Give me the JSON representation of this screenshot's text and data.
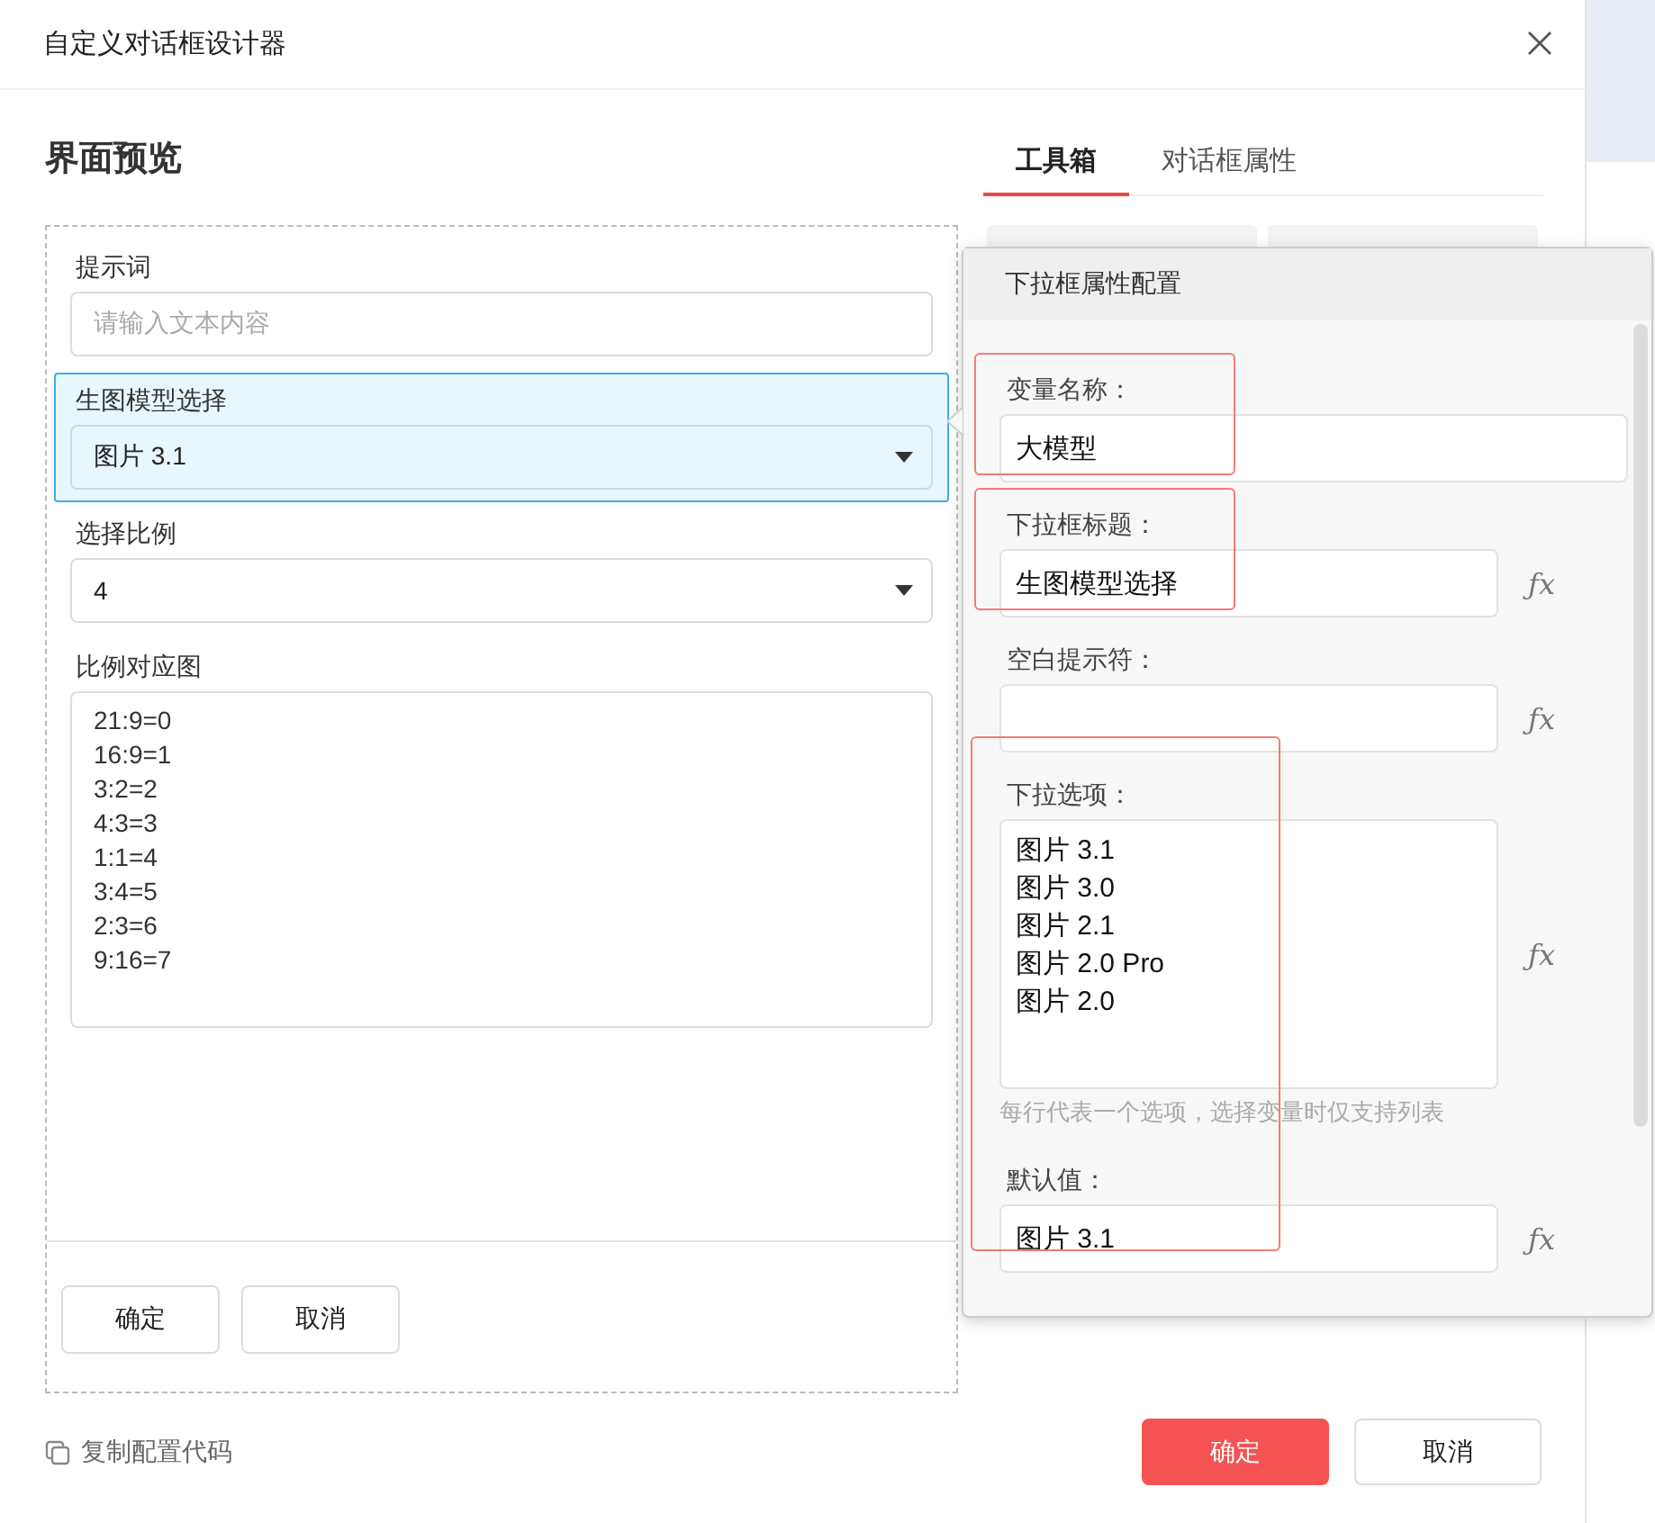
{
  "window": {
    "title": "自定义对话框设计器"
  },
  "preview": {
    "title": "界面预览",
    "items": [
      {
        "kind": "input",
        "label": "提示词",
        "placeholder": "请输入文本内容",
        "selected": false
      },
      {
        "kind": "select",
        "label": "生图模型选择",
        "value": "图片 3.1",
        "selected": true
      },
      {
        "kind": "select",
        "label": "选择比例",
        "value": "4",
        "selected": false
      },
      {
        "kind": "textarea",
        "label": "比例对应图",
        "value": "21:9=0\n16:9=1\n3:2=2\n4:3=3\n1:1=4\n3:4=5\n2:3=6\n9:16=7",
        "selected": false
      }
    ],
    "buttons": [
      "确定",
      "取消"
    ]
  },
  "copy_link": "复制配置代码",
  "tabs": [
    {
      "label": "工具箱",
      "selected": true
    },
    {
      "label": "对话框属性",
      "selected": false
    }
  ],
  "popover": {
    "title": "下拉框属性配置",
    "groups": [
      {
        "highlighted": true,
        "fields": [
          {
            "kind": "input",
            "label": "变量名称：",
            "value": "大模型"
          }
        ]
      },
      {
        "highlighted": true,
        "fields": [
          {
            "kind": "input",
            "label": "下拉框标题：",
            "value": "生图模型选择",
            "side_button": "ƒx"
          }
        ]
      },
      {
        "highlighted": false,
        "fields": [
          {
            "kind": "input",
            "label": "空白提示符：",
            "side_button": "ƒx"
          }
        ]
      },
      {
        "highlighted": true,
        "fields": [
          {
            "kind": "textarea",
            "label": "下拉选项：",
            "value": "图片 3.1\n图片 3.0\n图片 2.1\n图片 2.0 Pro\n图片 2.0",
            "side_button": "ƒx",
            "hint": "每行代表一个选项，选择变量时仅支持列表"
          },
          {
            "kind": "input",
            "label": "默认值：",
            "value": "图片 3.1",
            "side_button": "ƒx"
          }
        ]
      }
    ]
  },
  "footer_buttons": [
    {
      "label": "确定",
      "kind": "primary"
    },
    {
      "label": "取消",
      "kind": "default"
    }
  ]
}
